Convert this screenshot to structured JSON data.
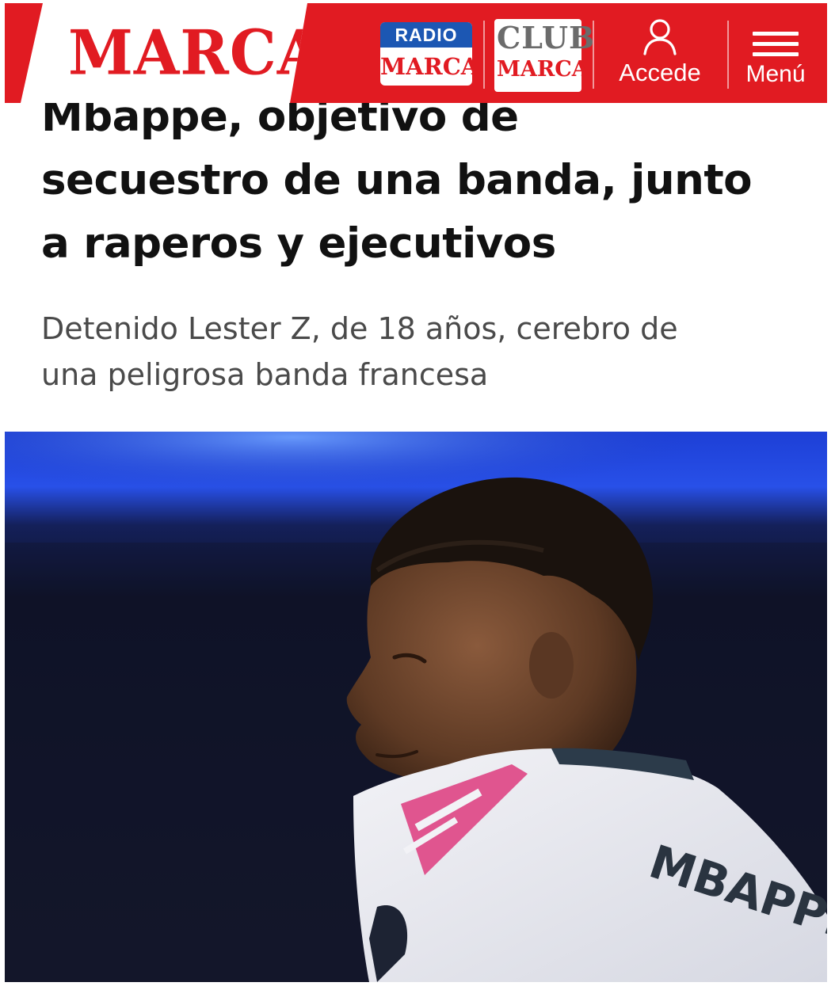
{
  "header": {
    "logo": "MARCA",
    "radio_badge": {
      "top": "RADIO",
      "bottom": "MARCA"
    },
    "club_badge": {
      "top": "CLUB",
      "bottom": "MARCA"
    },
    "login_label": "Accede",
    "menu_label": "Menú",
    "brand_color": "#e11b22",
    "radio_color": "#1c57b3"
  },
  "article": {
    "headline_lines": [
      "Mbappe, objetivo de",
      "secuestro de una banda, junto",
      "a raperos y ejecutivos"
    ],
    "subtitle_lines": [
      "Detenido Lester Z, de 18 años, cerebro de",
      "una peligrosa banda francesa"
    ]
  },
  "photo": {
    "jersey_name": "MBAPPÉ"
  },
  "icons": {
    "login": "user-icon",
    "menu": "hamburger-icon"
  }
}
